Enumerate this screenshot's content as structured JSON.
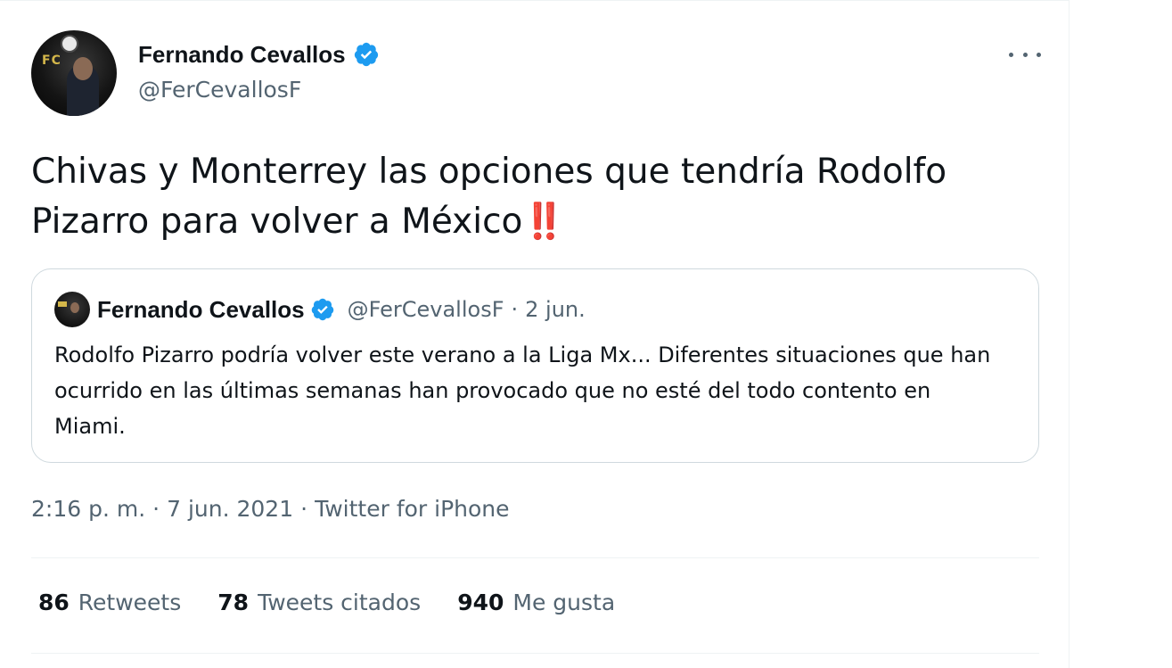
{
  "author": {
    "display_name": "Fernando Cevallos",
    "handle": "@FerCevallosF",
    "verified": true,
    "avatar_logo_text": "FC"
  },
  "tweet": {
    "text": "Chivas y Monterrey las opciones que tendría Rodolfo Pizarro para volver a México",
    "emoji": "‼️"
  },
  "quoted_tweet": {
    "display_name": "Fernando Cevallos",
    "handle": "@FerCevallosF",
    "separator": "·",
    "date": "2 jun.",
    "text": "Rodolfo Pizarro podría volver este verano a la Liga Mx... Diferentes situaciones que han ocurrido en las últimas semanas han provocado que no esté del todo contento en Miami."
  },
  "meta": {
    "time": "2:16 p. m.",
    "separator": "·",
    "date": "7 jun. 2021",
    "source": "Twitter for iPhone"
  },
  "stats": [
    {
      "count": "86",
      "label": "Retweets"
    },
    {
      "count": "78",
      "label": "Tweets citados"
    },
    {
      "count": "940",
      "label": "Me gusta"
    }
  ],
  "colors": {
    "verified_blue": "#1d9bf0",
    "text_primary": "#0f1419",
    "text_secondary": "#536471",
    "border": "#cfd9de",
    "emoji_red": "#cf1b2b"
  },
  "icons": {
    "verified": "verified-badge-icon",
    "more": "more-horizontal-icon"
  }
}
